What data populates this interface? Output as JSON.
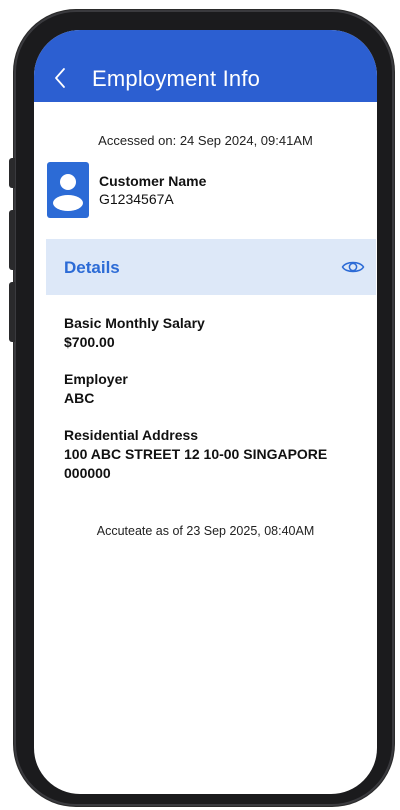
{
  "header": {
    "back_icon": "chevron-left-icon",
    "title": "Employment Info",
    "bg_color": "#2c5fd1"
  },
  "accessed_text": "Accessed on: 24 Sep 2024, 09:41AM",
  "customer": {
    "avatar_icon": "user-avatar-icon",
    "name": "Customer Name",
    "id": "G1234567A"
  },
  "details": {
    "title": "Details",
    "eye_icon": "eye-icon",
    "accent_color": "#2c6bd6",
    "bar_color": "#dde8f8"
  },
  "fields": [
    {
      "label": "Basic Monthly Salary",
      "value": "$700.00"
    },
    {
      "label": "Employer",
      "value": "ABC"
    },
    {
      "label": "Residential Address",
      "value": "100 ABC STREET 12 10-00 SINGAPORE 000000"
    }
  ],
  "accurate_text": "Accuteate as of 23 Sep 2025, 08:40AM"
}
